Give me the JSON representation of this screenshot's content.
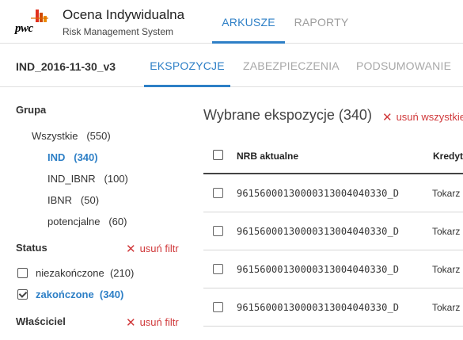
{
  "brand": {
    "wordmark": "pwc",
    "bar_colors": [
      "#e0301e",
      "#eb8c00",
      "#dc6900",
      "#d04a02",
      "#ffb600"
    ]
  },
  "header": {
    "title": "Ocena Indywidualna",
    "subtitle": "Risk Management System",
    "tabs": [
      {
        "label": "ARKUSZE",
        "active": true
      },
      {
        "label": "RAPORTY",
        "active": false
      }
    ]
  },
  "subheader": {
    "file_name": "IND_2016-11-30_v3",
    "tabs": [
      {
        "label": "EKSPOZYCJE",
        "active": true
      },
      {
        "label": "ZABEZPIECZENIA",
        "active": false
      },
      {
        "label": "PODSUMOWANIE",
        "active": false
      }
    ]
  },
  "sidebar": {
    "group": {
      "label": "Grupa",
      "items": [
        {
          "label": "Wszystkie",
          "count": "(550)"
        },
        {
          "label": "IND",
          "count": "(340)",
          "active": true
        },
        {
          "label": "IND_IBNR",
          "count": "(100)"
        },
        {
          "label": "IBNR",
          "count": "(50)"
        },
        {
          "label": "potencjalne",
          "count": "(60)"
        }
      ]
    },
    "status": {
      "label": "Status",
      "remove_filter": "usuń filtr",
      "items": [
        {
          "label": "niezakończone",
          "count": "(210)",
          "checked": false
        },
        {
          "label": "zakończone",
          "count": "(340)",
          "checked": true
        }
      ]
    },
    "owner": {
      "label": "Właściciel",
      "remove_filter": "usuń filtr"
    }
  },
  "main": {
    "title": "Wybrane ekspozycje (340)",
    "remove_filters": "usuń wszystkie filtry",
    "columns": [
      "NRB aktualne",
      "Kredytobiorca"
    ],
    "rows": [
      {
        "nrb": "96156000130000313004040330_D",
        "borrower": "Tokarz"
      },
      {
        "nrb": "96156000130000313004040330_D",
        "borrower": "Tokarz"
      },
      {
        "nrb": "96156000130000313004040330_D",
        "borrower": "Tokarz"
      },
      {
        "nrb": "96156000130000313004040330_D",
        "borrower": "Tokarz"
      }
    ]
  },
  "colors": {
    "accent": "#2d7fc6",
    "danger": "#d0393b",
    "inactive_tab": "#9e9e9e"
  }
}
